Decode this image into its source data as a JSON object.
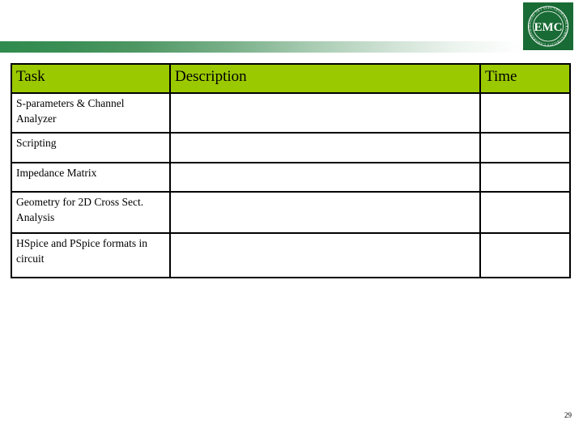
{
  "slide": {
    "page_number": "29",
    "logo": {
      "icon": "emc-seal-logo",
      "center_text": "EMC",
      "arc_top_text": "MISSOURI S&T ELECTROMAGNETIC",
      "arc_bottom_text": "COMPATIBILITY LABORATORY",
      "background_color": "#196b35",
      "foreground_color": "#ffffff"
    },
    "header_bar": {
      "start_color": "#2f8b4e",
      "end_color": "#ffffff"
    }
  },
  "table": {
    "header_background": "#9bc900",
    "border_color": "#000000",
    "columns": [
      {
        "key": "task",
        "label": "Task"
      },
      {
        "key": "description",
        "label": "Description"
      },
      {
        "key": "time",
        "label": "Time"
      }
    ],
    "rows": [
      {
        "task": "S-parameters & Channel Analyzer",
        "description": "",
        "time": ""
      },
      {
        "task": "Scripting",
        "description": "",
        "time": ""
      },
      {
        "task": "Impedance Matrix",
        "description": "",
        "time": ""
      },
      {
        "task": "Geometry for 2D Cross Sect. Analysis",
        "description": "",
        "time": ""
      },
      {
        "task": "HSpice and PSpice formats in circuit",
        "description": "",
        "time": ""
      }
    ]
  }
}
